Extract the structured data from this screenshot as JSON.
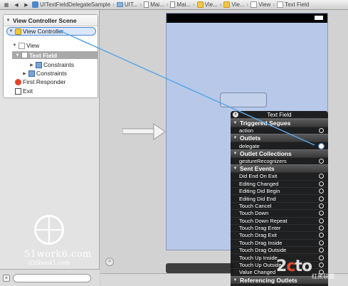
{
  "jumpbar": {
    "crumbs": [
      "UITextFieldDelegateSample",
      "UIT...",
      "Mai...",
      "Mai...",
      "Vie...",
      "Vie...",
      "View",
      "Text Field"
    ]
  },
  "outline": {
    "scene_title": "View Controller Scene",
    "items": {
      "view_controller": "View Controller",
      "view": "View",
      "text_field": "Text Field",
      "constraints_inner": "Constraints",
      "constraints_outer": "Constraints",
      "first_responder": "First Responder",
      "exit": "Exit"
    }
  },
  "watermark": {
    "big": "51work6.com",
    "small": "iOSbook1.com"
  },
  "hud": {
    "title": "Text Field",
    "sections": [
      {
        "label": "Triggered Segues",
        "items": [
          {
            "label": "action",
            "connected": false
          }
        ]
      },
      {
        "label": "Outlets",
        "items": [
          {
            "label": "delegate",
            "connected": true
          }
        ]
      },
      {
        "label": "Outlet Collections",
        "items": [
          {
            "label": "gestureRecognizers",
            "connected": false
          }
        ]
      },
      {
        "label": "Sent Events",
        "items": [
          {
            "label": "Did End On Exit",
            "connected": false
          },
          {
            "label": "Editing Changed",
            "connected": false
          },
          {
            "label": "Editing Did Begin",
            "connected": false
          },
          {
            "label": "Editing Did End",
            "connected": false
          },
          {
            "label": "Touch Cancel",
            "connected": false
          },
          {
            "label": "Touch Down",
            "connected": false
          },
          {
            "label": "Touch Down Repeat",
            "connected": false
          },
          {
            "label": "Touch Drag Enter",
            "connected": false
          },
          {
            "label": "Touch Drag Exit",
            "connected": false
          },
          {
            "label": "Touch Drag Inside",
            "connected": false
          },
          {
            "label": "Touch Drag Outside",
            "connected": false
          },
          {
            "label": "Touch Up Inside",
            "connected": false
          },
          {
            "label": "Touch Up Outside",
            "connected": false
          },
          {
            "label": "Value Changed",
            "connected": false
          }
        ]
      },
      {
        "label": "Referencing Outlets",
        "items": []
      }
    ]
  },
  "logo": {
    "prefix": "2",
    "accent": "c",
    "suffix": "to",
    "sub": "红黑联盟"
  },
  "colors": {
    "connection_line": "#5aa6e6",
    "hud_bg": "#181818",
    "canvas_view": "#b8c8e8"
  }
}
